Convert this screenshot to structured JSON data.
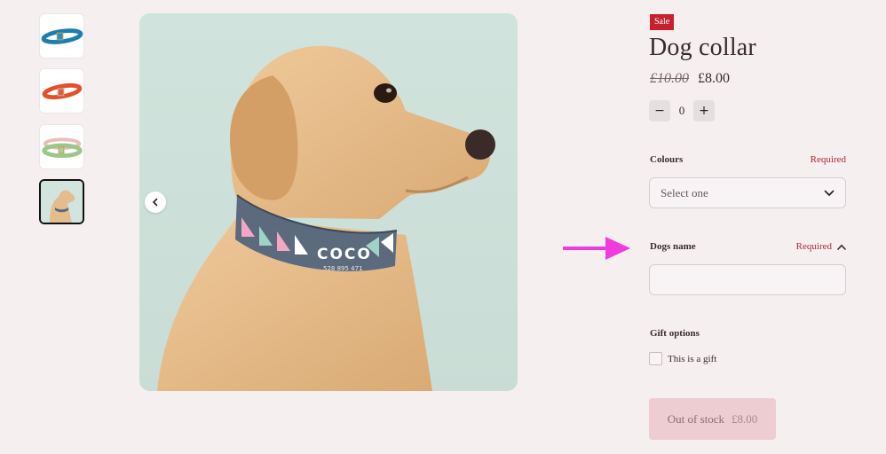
{
  "gallery": {
    "thumbnails": [
      {
        "name": "blue collar"
      },
      {
        "name": "red collar"
      },
      {
        "name": "green collar"
      },
      {
        "name": "dog wearing collar"
      }
    ],
    "main_image": {
      "collar_name": "COCO",
      "collar_phone": "528 895 471"
    }
  },
  "product": {
    "badge": "Sale",
    "title": "Dog collar",
    "price_old": "£10.00",
    "price_new": "£8.00",
    "quantity": "0",
    "qty_minus": "−",
    "qty_plus": "+"
  },
  "options": {
    "colours": {
      "label": "Colours",
      "required": "Required",
      "select_value": "Select one"
    },
    "dogs_name": {
      "label": "Dogs name",
      "required": "Required",
      "value": ""
    },
    "gift": {
      "label": "Gift options",
      "checkbox_label": "This is a gift"
    }
  },
  "cta": {
    "label": "Out of stock",
    "price": "£8.00"
  },
  "colors": {
    "background": "#f5eff0",
    "sale_red": "#c8202f",
    "required_red": "#b0272f",
    "annotation_magenta": "#f03cdc",
    "cta_bg": "#edcdd2"
  }
}
